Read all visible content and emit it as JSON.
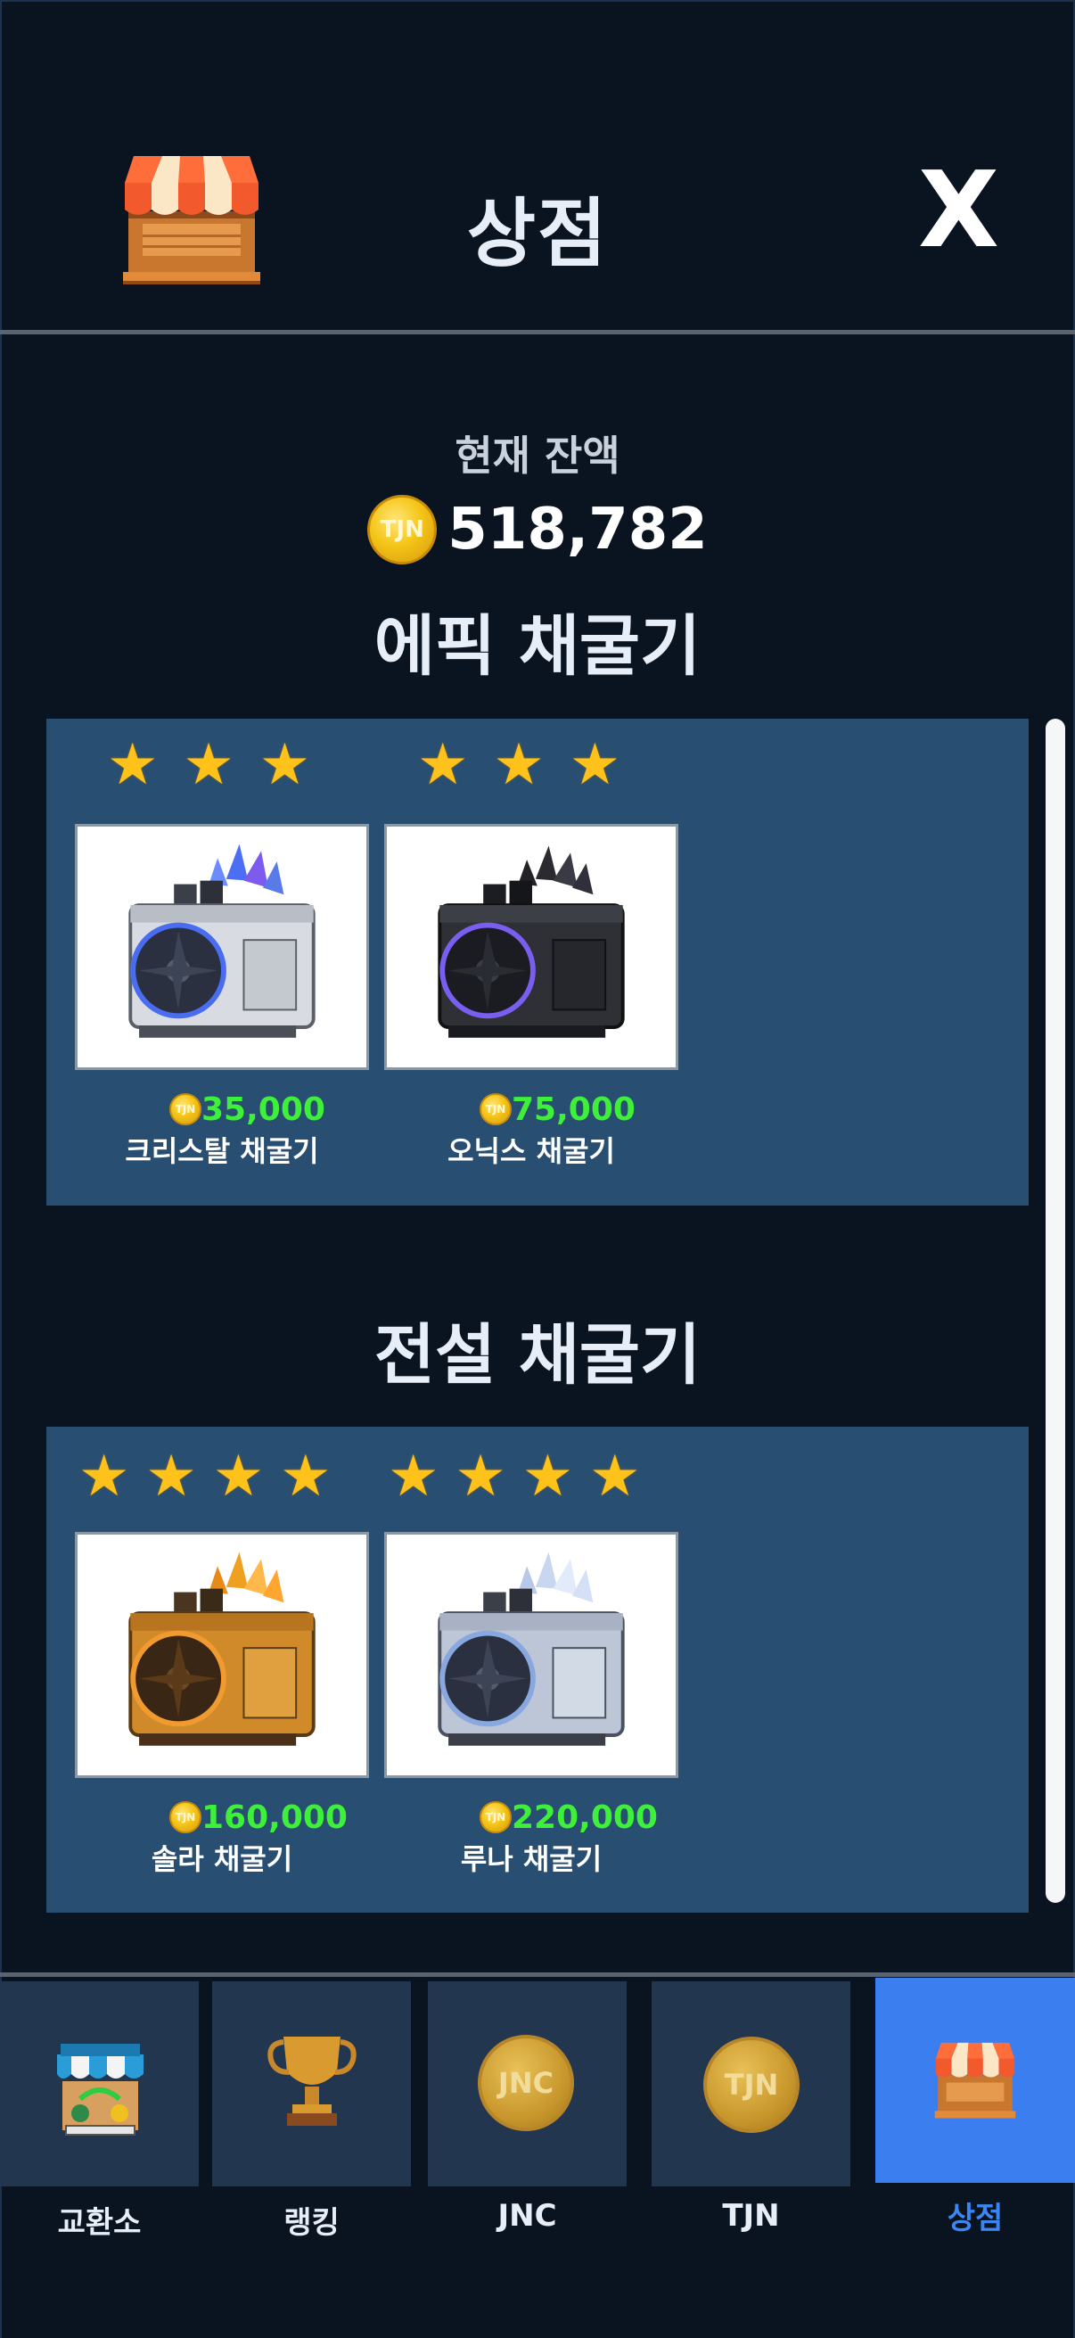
{
  "header": {
    "title": "상점",
    "close_label": "X"
  },
  "balance": {
    "label": "현재 잔액",
    "coin": "TJN",
    "value": "518,782"
  },
  "sections": [
    {
      "title": "에픽 채굴기",
      "items": [
        {
          "name": "크리스탈 채굴기",
          "price": "35,000",
          "coin": "TJN",
          "stars": 3,
          "color": "#6a8cff"
        },
        {
          "name": "오닉스 채굴기",
          "price": "75,000",
          "coin": "TJN",
          "stars": 3,
          "color": "#2a2a30"
        }
      ]
    },
    {
      "title": "전설 채굴기",
      "items": [
        {
          "name": "솔라 채굴기",
          "price": "160,000",
          "coin": "TJN",
          "stars": 4,
          "color": "#e88a1a"
        },
        {
          "name": "루나 채굴기",
          "price": "220,000",
          "coin": "TJN",
          "stars": 4,
          "color": "#b8c8e8"
        }
      ]
    }
  ],
  "nav": {
    "items": [
      {
        "label": "교환소",
        "icon": "exchange-stall-icon"
      },
      {
        "label": "랭킹",
        "icon": "trophy-icon"
      },
      {
        "label": "JNC",
        "icon": "jnc-coin-icon",
        "coin_text": "JNC"
      },
      {
        "label": "TJN",
        "icon": "tjn-coin-icon",
        "coin_text": "TJN"
      },
      {
        "label": "상점",
        "icon": "store-icon",
        "active": true
      }
    ]
  },
  "colors": {
    "background": "#0a1421",
    "panel": "#284f72",
    "price": "#3ef03a",
    "active_tab": "#3a7ef0"
  }
}
